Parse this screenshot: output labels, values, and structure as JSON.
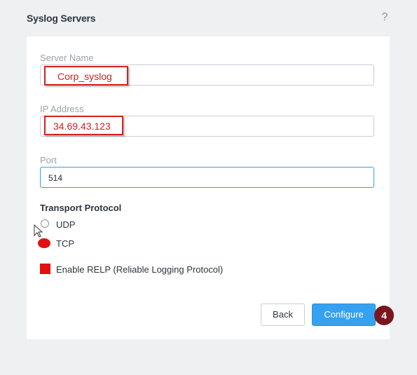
{
  "dialog": {
    "title": "Syslog Servers",
    "help_glyph": "?"
  },
  "form": {
    "server_name": {
      "label": "Server Name",
      "value": "Corp_syslog"
    },
    "ip_address": {
      "label": "IP Address",
      "value": "34.69.43.123"
    },
    "port": {
      "label": "Port",
      "value": "514"
    },
    "transport": {
      "title": "Transport Protocol",
      "options": [
        "UDP",
        "TCP"
      ],
      "selected": "TCP"
    },
    "relp": {
      "label": "Enable RELP (Reliable Logging Protocol)",
      "checked": true
    }
  },
  "buttons": {
    "back": "Back",
    "configure": "Configure"
  },
  "annotation": {
    "step": "4"
  },
  "colors": {
    "highlight": "#d42020",
    "primary": "#36a1f0",
    "badge": "#7a1620"
  },
  "icons": {
    "cursor": "mouse-pointer-icon",
    "help": "help-icon"
  }
}
